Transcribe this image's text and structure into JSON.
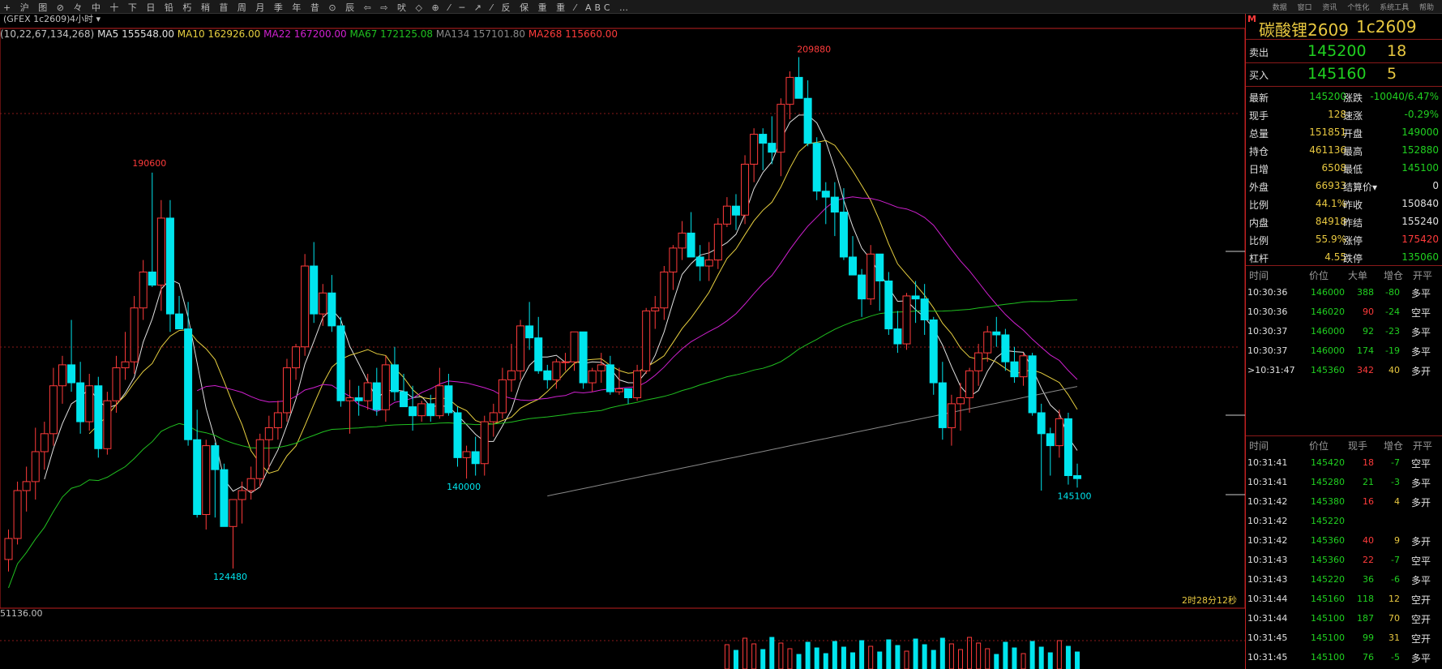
{
  "toolbar": {
    "icons": "+ 沪 图 ⊘ 々 中 十 下 日 铅 朽 稍 苜 周 月 季 年 昔 ⊙ 辰 ⇦ ⇨ 吠 ◇ ⊕ ⁄ ─ ↗ ⁄ 反 保 重 重 ⁄ ABC …",
    "right_menu": "数据 窗口 资讯 个性化 系统工具 帮助"
  },
  "chart": {
    "period_prefix": "(GFEX 1c2609)",
    "period_label": "4小时",
    "ma_params": "(10,22,67,134,268)",
    "ma": [
      {
        "label": "MA5 155548.00",
        "color": "#e0e0e0"
      },
      {
        "label": "MA10 162926.00",
        "color": "#e8d040"
      },
      {
        "label": "MA22 167200.00",
        "color": "#d020d0"
      },
      {
        "label": "MA67 172125.08",
        "color": "#20c020"
      },
      {
        "label": "MA134 157101.80",
        "color": "#888888"
      },
      {
        "label": "MA268 115660.00",
        "color": "#ff3b3b"
      }
    ],
    "annotations": {
      "high1": "190600",
      "low1": "124480",
      "low2": "140000",
      "high2": "209880",
      "last": "145100"
    },
    "countdown": "2时28分12秒",
    "volume_label": "51136.00",
    "colors": {
      "up": "#ff3b3b",
      "down": "#00e5ee",
      "ma5": "#e0e0e0",
      "ma10": "#e8d040",
      "ma22": "#d020d0",
      "ma67": "#20c020",
      "ma134": "#888888"
    }
  },
  "chart_data": {
    "type": "candlestick",
    "title": "碳酸锂2609 1c2609",
    "ylim": [
      118000,
      214000
    ],
    "candles": [
      [
        126000,
        131000,
        124000,
        129500
      ],
      [
        129500,
        139000,
        128500,
        137500
      ],
      [
        137500,
        141500,
        134000,
        139000
      ],
      [
        139000,
        148000,
        136000,
        144000
      ],
      [
        144000,
        149000,
        141000,
        147000
      ],
      [
        147000,
        158000,
        145000,
        155000
      ],
      [
        155000,
        160000,
        152000,
        158500
      ],
      [
        158500,
        166000,
        154000,
        155500
      ],
      [
        155500,
        159000,
        147000,
        149000
      ],
      [
        149000,
        157000,
        147500,
        155000
      ],
      [
        155000,
        156500,
        143000,
        144500
      ],
      [
        144500,
        154000,
        143500,
        152500
      ],
      [
        152500,
        160000,
        150500,
        158000
      ],
      [
        158000,
        164000,
        156000,
        159000
      ],
      [
        159000,
        170000,
        157000,
        168000
      ],
      [
        168000,
        176000,
        166000,
        174000
      ],
      [
        174000,
        190600,
        171500,
        171800
      ],
      [
        171800,
        186000,
        167500,
        183000
      ],
      [
        183000,
        186000,
        164000,
        167000
      ],
      [
        167000,
        170000,
        164500,
        164500
      ],
      [
        164500,
        169000,
        145000,
        146000
      ],
      [
        146000,
        151000,
        133000,
        133500
      ],
      [
        133500,
        146000,
        131000,
        145000
      ],
      [
        145000,
        145500,
        133000,
        141000
      ],
      [
        141000,
        142000,
        131500,
        131500
      ],
      [
        131500,
        136000,
        124480,
        136000
      ],
      [
        136000,
        139000,
        132000,
        137500
      ],
      [
        137500,
        141500,
        136000,
        139500
      ],
      [
        139500,
        147000,
        138000,
        146000
      ],
      [
        146000,
        150000,
        141000,
        148000
      ],
      [
        148000,
        152500,
        146000,
        150500
      ],
      [
        150500,
        159500,
        149000,
        158000
      ],
      [
        158000,
        162000,
        156000,
        161500
      ],
      [
        161500,
        177000,
        160000,
        175000
      ],
      [
        175000,
        179000,
        165500,
        167000
      ],
      [
        167000,
        172000,
        165000,
        170500
      ],
      [
        170500,
        173500,
        164000,
        165000
      ],
      [
        165000,
        166500,
        151500,
        152500
      ],
      [
        152500,
        156000,
        147000,
        153000
      ],
      [
        153000,
        155000,
        150000,
        152500
      ],
      [
        152500,
        157000,
        151000,
        155500
      ],
      [
        155500,
        158000,
        150000,
        151000
      ],
      [
        151000,
        160000,
        149000,
        158500
      ],
      [
        158500,
        161500,
        152500,
        154000
      ],
      [
        154000,
        157000,
        151500,
        151500
      ],
      [
        151500,
        155000,
        147500,
        150000
      ],
      [
        150000,
        152500,
        149000,
        152000
      ],
      [
        152000,
        153500,
        149000,
        150000
      ],
      [
        150000,
        158000,
        149500,
        155000
      ],
      [
        155000,
        157000,
        150000,
        150500
      ],
      [
        150500,
        151500,
        141500,
        143000
      ],
      [
        143000,
        145000,
        139500,
        144000
      ],
      [
        144000,
        146500,
        140000,
        142000
      ],
      [
        142000,
        150000,
        140000,
        149000
      ],
      [
        149000,
        152000,
        146500,
        150500
      ],
      [
        150500,
        158000,
        149500,
        156000
      ],
      [
        156000,
        162000,
        154000,
        157500
      ],
      [
        157500,
        166000,
        156000,
        165000
      ],
      [
        165000,
        169000,
        161000,
        163000
      ],
      [
        163000,
        166500,
        157000,
        157500
      ],
      [
        157500,
        158500,
        154500,
        156000
      ],
      [
        156000,
        159500,
        154500,
        159000
      ],
      [
        159000,
        160500,
        157500,
        159000
      ],
      [
        159000,
        164000,
        157500,
        164000
      ],
      [
        164000,
        164000,
        154500,
        155500
      ],
      [
        155500,
        158000,
        154000,
        157500
      ],
      [
        157500,
        160500,
        155500,
        158500
      ],
      [
        158500,
        160000,
        153500,
        154000
      ],
      [
        154000,
        158000,
        153500,
        154500
      ],
      [
        154500,
        154500,
        152000,
        153000
      ],
      [
        153000,
        158500,
        152500,
        157500
      ],
      [
        157500,
        168000,
        157000,
        167500
      ],
      [
        167500,
        170000,
        164500,
        168000
      ],
      [
        168000,
        175000,
        166000,
        174000
      ],
      [
        174000,
        178500,
        171000,
        178000
      ],
      [
        178000,
        182500,
        176000,
        180500
      ],
      [
        180500,
        184000,
        177000,
        176500
      ],
      [
        176500,
        178500,
        172500,
        175000
      ],
      [
        175000,
        179000,
        172500,
        176000
      ],
      [
        176000,
        183000,
        174500,
        182000
      ],
      [
        182000,
        186500,
        181500,
        185000
      ],
      [
        185000,
        187000,
        181000,
        183500
      ],
      [
        183500,
        193500,
        182000,
        192000
      ],
      [
        192000,
        198000,
        189000,
        197000
      ],
      [
        197000,
        198000,
        191000,
        195500
      ],
      [
        195500,
        200000,
        192000,
        194000
      ],
      [
        194000,
        203000,
        190000,
        202000
      ],
      [
        202000,
        207500,
        199500,
        206500
      ],
      [
        206500,
        209880,
        203500,
        203000
      ],
      [
        203000,
        206000,
        195000,
        195500
      ],
      [
        195500,
        196500,
        186000,
        187500
      ],
      [
        187500,
        189000,
        182000,
        186500
      ],
      [
        186500,
        189000,
        180000,
        184000
      ],
      [
        184000,
        188000,
        176000,
        176500
      ],
      [
        176500,
        180000,
        173500,
        173500
      ],
      [
        173500,
        174500,
        166500,
        169500
      ],
      [
        169500,
        178500,
        168500,
        177000
      ],
      [
        177000,
        177000,
        167500,
        172500
      ],
      [
        172500,
        174000,
        163500,
        164500
      ],
      [
        164500,
        167500,
        160500,
        162000
      ],
      [
        162000,
        170500,
        161000,
        170000
      ],
      [
        170000,
        172500,
        165500,
        169500
      ],
      [
        169500,
        172000,
        163500,
        166000
      ],
      [
        166000,
        166500,
        153500,
        155500
      ],
      [
        155500,
        159000,
        146000,
        148000
      ],
      [
        148000,
        153500,
        145000,
        152000
      ],
      [
        152000,
        155500,
        147500,
        153000
      ],
      [
        153000,
        158000,
        150500,
        157500
      ],
      [
        157500,
        162000,
        155000,
        160500
      ],
      [
        160500,
        165000,
        159000,
        164000
      ],
      [
        164000,
        166500,
        161500,
        163500
      ],
      [
        163500,
        164500,
        157500,
        159000
      ],
      [
        159000,
        161500,
        155500,
        156500
      ],
      [
        156500,
        160500,
        155000,
        160000
      ],
      [
        160000,
        160500,
        150000,
        150500
      ],
      [
        150500,
        152000,
        137500,
        147000
      ],
      [
        147000,
        148000,
        140000,
        145000
      ],
      [
        145000,
        151000,
        143000,
        149500
      ],
      [
        149500,
        150500,
        138500,
        140000
      ],
      [
        140000,
        142000,
        138000,
        139500
      ]
    ]
  },
  "quote": {
    "title": "碳酸锂2609",
    "code": "1c2609",
    "m_badge": "M",
    "ask": {
      "label": "卖出",
      "price": "145200",
      "vol": "18"
    },
    "bid": {
      "label": "买入",
      "price": "145160",
      "vol": "5"
    },
    "stats": [
      {
        "l1": "最新",
        "v1": "145200",
        "c1": "grn",
        "l2": "涨跌",
        "v2": "-10040/6.47%",
        "c2": "grn"
      },
      {
        "l1": "现手",
        "v1": "128",
        "c1": "ylw",
        "l2": "速涨",
        "v2": "-0.29%",
        "c2": "grn"
      },
      {
        "l1": "总量",
        "v1": "151851",
        "c1": "ylw",
        "l2": "开盘",
        "v2": "149000",
        "c2": "grn"
      },
      {
        "l1": "持仓",
        "v1": "461136",
        "c1": "ylw",
        "l2": "最高",
        "v2": "152880",
        "c2": "grn"
      },
      {
        "l1": "日增",
        "v1": "6508",
        "c1": "ylw",
        "l2": "最低",
        "v2": "145100",
        "c2": "grn"
      },
      {
        "l1": "外盘",
        "v1": "66933",
        "c1": "ylw",
        "l2": "结算价▾",
        "v2": "0",
        "c2": "wht"
      },
      {
        "l1": "比例",
        "v1": "44.1%",
        "c1": "ylw",
        "l2": "昨收",
        "v2": "150840",
        "c2": "wht"
      },
      {
        "l1": "内盘",
        "v1": "84918",
        "c1": "ylw",
        "l2": "昨结",
        "v2": "155240",
        "c2": "wht"
      },
      {
        "l1": "比例",
        "v1": "55.9%",
        "c1": "ylw",
        "l2": "涨停",
        "v2": "175420",
        "c2": "red"
      },
      {
        "l1": "杠杆",
        "v1": "4.55",
        "c1": "ylw",
        "l2": "跌停",
        "v2": "135060",
        "c2": "grn"
      }
    ],
    "big_orders": {
      "headers": [
        "时间",
        "价位",
        "大单",
        "增仓",
        "开平"
      ],
      "rows": [
        {
          "time": "10:30:36",
          "price": "146000",
          "vol": "388",
          "vc": "grn",
          "chg": "-80",
          "type": "多平"
        },
        {
          "time": "10:30:36",
          "price": "146020",
          "vol": "90",
          "vc": "red",
          "chg": "-24",
          "type": "空平"
        },
        {
          "time": "10:30:37",
          "price": "146000",
          "vol": "92",
          "vc": "grn",
          "chg": "-23",
          "type": "多平"
        },
        {
          "time": "10:30:37",
          "price": "146000",
          "vol": "174",
          "vc": "grn",
          "chg": "-19",
          "type": "多平"
        },
        {
          "time": ">10:31:47",
          "price": "145360",
          "vol": "342",
          "vc": "red",
          "chg": "40",
          "type": "多开"
        }
      ]
    },
    "ticks": {
      "headers": [
        "时间",
        "价位",
        "现手",
        "增仓",
        "开平"
      ],
      "rows": [
        {
          "time": "10:31:41",
          "price": "145420",
          "vol": "18",
          "vc": "red",
          "chg": "-7",
          "type": "空平"
        },
        {
          "time": "10:31:41",
          "price": "145280",
          "vol": "21",
          "vc": "grn",
          "chg": "-3",
          "type": "多平"
        },
        {
          "time": "10:31:42",
          "price": "145380",
          "vol": "16",
          "vc": "red",
          "chg": "4",
          "type": "多开"
        },
        {
          "time": "10:31:42",
          "price": "145220",
          "vol": "",
          "vc": "grn",
          "chg": "",
          "type": ""
        },
        {
          "time": "10:31:42",
          "price": "145360",
          "vol": "40",
          "vc": "red",
          "chg": "9",
          "type": "多开"
        },
        {
          "time": "10:31:43",
          "price": "145360",
          "vol": "22",
          "vc": "red",
          "chg": "-7",
          "type": "空平"
        },
        {
          "time": "10:31:43",
          "price": "145220",
          "vol": "36",
          "vc": "grn",
          "chg": "-6",
          "type": "多平"
        },
        {
          "time": "10:31:44",
          "price": "145160",
          "vol": "118",
          "vc": "grn",
          "chg": "12",
          "type": "空开"
        },
        {
          "time": "10:31:44",
          "price": "145100",
          "vol": "187",
          "vc": "grn",
          "chg": "70",
          "type": "空开"
        },
        {
          "time": "10:31:45",
          "price": "145100",
          "vol": "99",
          "vc": "grn",
          "chg": "31",
          "type": "空开"
        },
        {
          "time": "10:31:45",
          "price": "145100",
          "vol": "76",
          "vc": "grn",
          "chg": "-5",
          "type": "多平"
        }
      ]
    }
  }
}
